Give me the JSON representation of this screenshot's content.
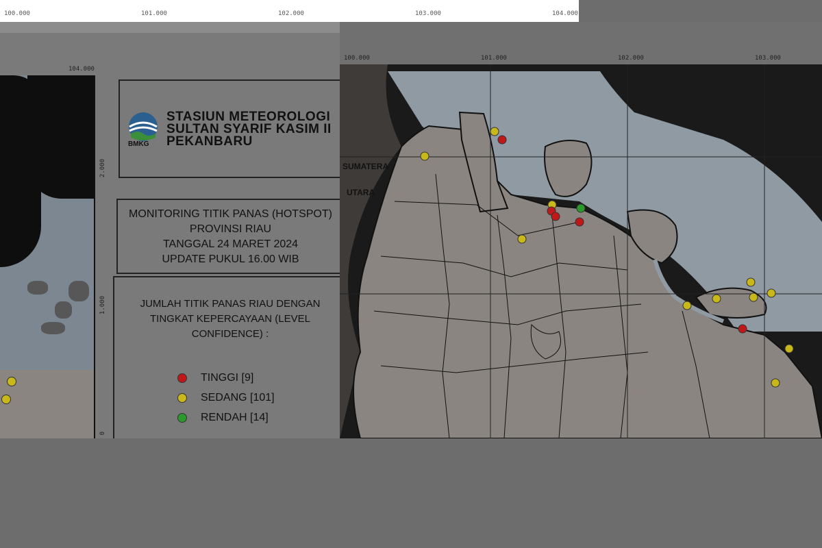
{
  "top_ticks": [
    "100.000",
    "101.000",
    "102.000",
    "103.000",
    "104.000"
  ],
  "left_map": {
    "lon_tick": "104.000",
    "lat_ticks": [
      "2.000",
      "1.000",
      "0"
    ]
  },
  "header": {
    "logo_text": "BMKG",
    "station_lines": [
      "STASIUN METEOROLOGI",
      "SULTAN SYARIF KASIM II",
      "PEKANBARU"
    ]
  },
  "monitoring": {
    "lines": [
      "MONITORING TITIK PANAS (HOTSPOT)",
      "PROVINSI RIAU",
      "TANGGAL 24 MARET 2024",
      "UPDATE PUKUL 16.00 WIB"
    ]
  },
  "legend": {
    "intro_lines": [
      "JUMLAH TITIK PANAS RIAU DENGAN",
      "TINGKAT KEPERCAYAAN (LEVEL",
      "CONFIDENCE) :"
    ],
    "items": [
      {
        "label": "TINGGI [9]",
        "color": "#c01818"
      },
      {
        "label": "SEDANG [101]",
        "color": "#c9b81a"
      },
      {
        "label": "RENDAH [14]",
        "color": "#2a9a2a"
      }
    ]
  },
  "right_map": {
    "lon_ticks": [
      "100.000",
      "101.000",
      "102.000",
      "103.000"
    ],
    "province_labels": [
      "SUMATERA",
      "UTARA"
    ],
    "colors": {
      "land": "#8a8580",
      "sea": "#8f9aa3",
      "outside": "#3f3b38",
      "border": "#111111"
    }
  }
}
